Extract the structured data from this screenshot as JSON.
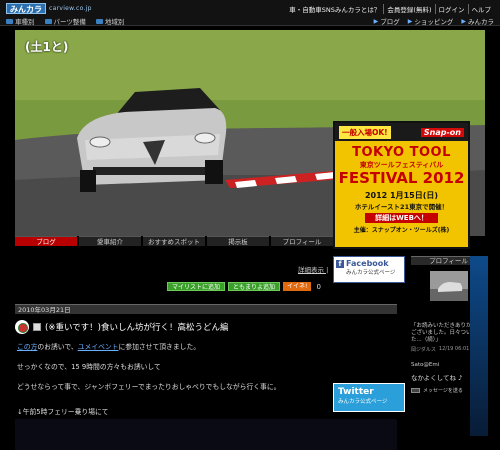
{
  "header": {
    "logo": "みんカラ",
    "logo_sub": "carview.co.jp",
    "links": [
      "車・自動車SNSみんカラとは？",
      "会員登録(無料)",
      "ログイン",
      "ヘルプ"
    ],
    "nav": [
      {
        "label": "車種別",
        "icon": "car-icon"
      },
      {
        "label": "パーツ整備",
        "icon": "wrench-icon"
      },
      {
        "label": "地域別",
        "icon": "map-icon"
      }
    ],
    "right_nav": [
      "ブログ",
      "ショッピング",
      "みんカラ"
    ]
  },
  "hero": {
    "title": "(土1と)"
  },
  "ad_banner": {
    "badge": "一般入場OK!",
    "brand": "Snap-on",
    "title1": "TOKYO TOOL",
    "title2": "東京ツールフェスティバル",
    "title3": "FESTIVAL 2012",
    "date": "2012 1月15日(日)",
    "venue": "ホテルイースト21東京で開催！",
    "web": "詳細はWEBへ！",
    "organizer": "主催：スナップオン・ツールズ(株)"
  },
  "tabs": [
    {
      "label": "ブログ",
      "active": true
    },
    {
      "label": "愛車紹介",
      "active": false
    },
    {
      "label": "おすすめスポット",
      "active": false
    },
    {
      "label": "掲示板",
      "active": false
    },
    {
      "label": "プロフィール",
      "active": false
    }
  ],
  "comment_link": "詳細表示 |",
  "actions": {
    "mylist": "マイリストに追加",
    "favorite": "ともまりよ追加",
    "iine": "イイネ!",
    "iine_count": "0"
  },
  "facebook_ad": {
    "title": "Facebook",
    "sub": "みんカラ公式ページ"
  },
  "twitter_ad": {
    "title": "Twitter",
    "sub": "みんカラ公式ページ"
  },
  "post": {
    "date": "2010年03月21日",
    "title": "(※重いです！)食いしん坊が行く！高松うどん編",
    "body1_link": "この方",
    "body1_mid": "のお誘いで、",
    "body1_link2": "ユメイベント",
    "body1_end": "に参加させて頂きました。",
    "body2": "せっかくなので、15 9時間の方々もお誘いして",
    "body3": "どうせならって事で、ジャンボフェリーでまったりおしゃべりでもしながら行く事に。",
    "body4": "↓午前5時フェリー乗り場にて"
  },
  "sidebar": {
    "header": "プロフィール",
    "line1": "「お読みいただきありがとうございました。日々ついていた...（続）」",
    "line2_user": "岡ジダルス",
    "line2_time": "12/19 06:01",
    "line3": "Sato@Emi",
    "line4": "なかよくしてね ♪",
    "line5": "メッセージを送る"
  }
}
